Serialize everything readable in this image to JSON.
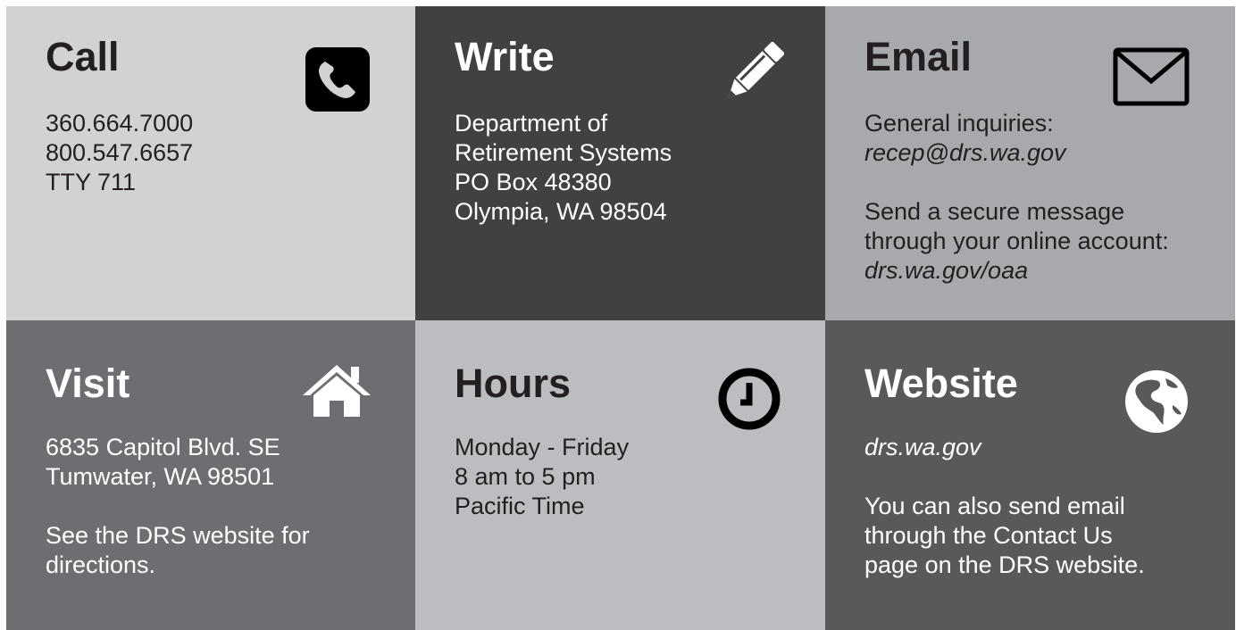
{
  "tiles": {
    "call": {
      "title": "Call",
      "line1": "360.664.7000",
      "line2": "800.547.6657",
      "line3": "TTY  711",
      "icon": "phone-icon"
    },
    "write": {
      "title": "Write",
      "line1": "Department of",
      "line2": "Retirement Systems",
      "line3": "PO Box 48380",
      "line4": "Olympia, WA  98504",
      "icon": "pencil-icon"
    },
    "email": {
      "title": "Email",
      "line1": "General inquiries:",
      "line2": "recep@drs.wa.gov",
      "line3": "Send a secure message",
      "line4": "through your online account:",
      "line5": "drs.wa.gov/oaa",
      "icon": "envelope-icon"
    },
    "visit": {
      "title": "Visit",
      "line1": "6835 Capitol Blvd. SE",
      "line2": "Tumwater, WA  98501",
      "line3": "See the DRS website for",
      "line4": "directions.",
      "icon": "home-icon"
    },
    "hours": {
      "title": "Hours",
      "line1": "Monday - Friday",
      "line2": "8 am to 5 pm",
      "line3": "Pacific Time",
      "icon": "clock-icon"
    },
    "website": {
      "title": "Website",
      "line1": "drs.wa.gov",
      "line2": "You can also send email",
      "line3": "through the Contact Us",
      "line4": "page on the DRS website.",
      "icon": "globe-icon"
    }
  },
  "colors": {
    "call_bg": "#d1d2d4",
    "write_bg": "#414042",
    "email_bg": "#a7a9ac",
    "visit_bg": "#6d6e71",
    "hours_bg": "#bcbdc0",
    "website_bg": "#58595b"
  }
}
